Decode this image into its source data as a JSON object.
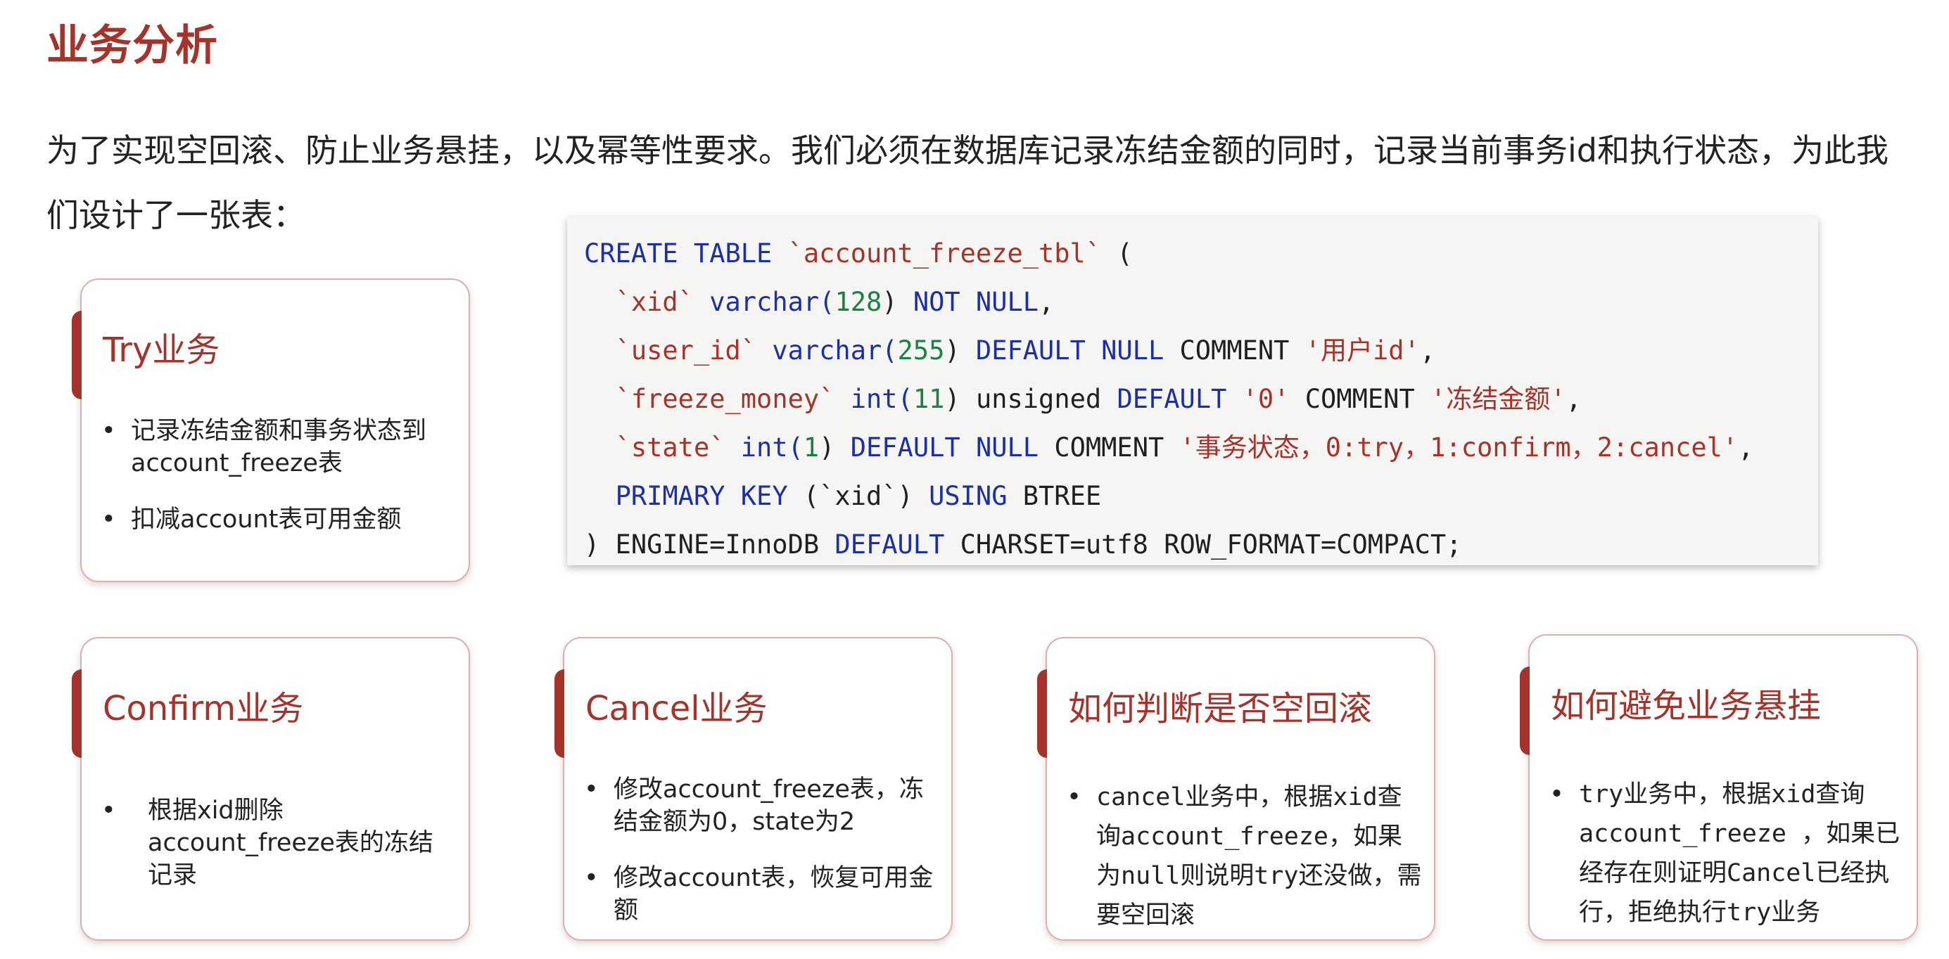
{
  "title": "业务分析",
  "intro": "为了实现空回滚、防止业务悬挂，以及幂等性要求。我们必须在数据库记录冻结金额的同时，记录当前事务id和执行状态，为此我们设计了一张表：",
  "code": {
    "line1": {
      "kw1": "CREATE TABLE",
      "name": "`account_freeze_tbl`",
      "rest": " ("
    },
    "line2": {
      "indent": "  ",
      "col": "`xid`",
      "type": " varchar(",
      "num": "128",
      "close": ") ",
      "kw": "NOT NULL",
      "end": ","
    },
    "line3": {
      "indent": "  ",
      "col": "`user_id`",
      "type": " varchar(",
      "num": "255",
      "close": ") ",
      "kw": "DEFAULT NULL",
      "comment": " COMMENT ",
      "str": "'用户id'",
      "end": ","
    },
    "line4": {
      "indent": "  ",
      "col": "`freeze_money`",
      "type": " int(",
      "num": "11",
      "close": ") unsigned ",
      "kw": "DEFAULT",
      "space": " ",
      "default": "'0'",
      "comment": " COMMENT ",
      "str": "'冻结金额'",
      "end": ","
    },
    "line5": {
      "indent": "  ",
      "col": "`state`",
      "type": " int(",
      "num": "1",
      "close": ") ",
      "kw": "DEFAULT NULL",
      "comment": " COMMENT ",
      "str": "'事务状态，0:try，1:confirm，2:cancel'",
      "end": ","
    },
    "line6": {
      "indent": "  ",
      "kw1": "PRIMARY KEY",
      "mid": " (`xid`) ",
      "kw2": "USING",
      "end": " BTREE"
    },
    "line7": {
      "start": ") ENGINE=InnoDB ",
      "kw": "DEFAULT",
      "end": " CHARSET=utf8 ROW_FORMAT=COMPACT;"
    }
  },
  "cards": {
    "try": {
      "title": "Try业务",
      "items": [
        "记录冻结金额和事务状态到account_freeze表",
        "扣减account表可用金额"
      ]
    },
    "confirm": {
      "title": "Confirm业务",
      "items": [
        "根据xid删除account_freeze表的冻结记录"
      ]
    },
    "cancel": {
      "title": "Cancel业务",
      "items": [
        "修改account_freeze表，冻结金额为0，state为2",
        "修改account表，恢复可用金额"
      ]
    },
    "empty_rollback": {
      "title": "如何判断是否空回滚",
      "items": [
        "cancel业务中，根据xid查询account_freeze，如果为null则说明try还没做，需要空回滚"
      ]
    },
    "suspend": {
      "title": "如何避免业务悬挂",
      "items": [
        "try业务中，根据xid查询account_freeze ，如果已经存在则证明Cancel已经执行，拒绝执行try业务"
      ]
    }
  },
  "colors": {
    "accent": "#a4332b",
    "keyword": "#1c2fa6",
    "number": "#1e7e48",
    "code_bg": "#f5f5f3"
  }
}
